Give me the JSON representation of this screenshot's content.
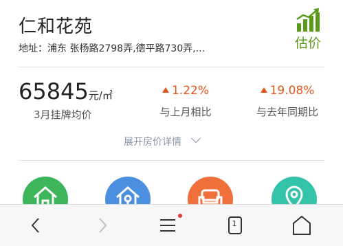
{
  "header": {
    "title": "仁和花苑",
    "address": "地址：浦东 张杨路2798弄,德平路730弄,...",
    "estimate_label": "估价"
  },
  "price": {
    "value": "65845",
    "unit": "元/㎡",
    "label": "3月挂牌均价"
  },
  "stats": [
    {
      "value": "1.22%",
      "label": "与上月相比"
    },
    {
      "value": "19.08%",
      "label": "与去年同期比"
    }
  ],
  "expand_label": "展开房价详情",
  "categories": [
    {
      "icon": "house-icon",
      "color": "#3cb55b"
    },
    {
      "icon": "home-location-icon",
      "color": "#4a8fe0"
    },
    {
      "icon": "sofa-icon",
      "color": "#f0703c"
    },
    {
      "icon": "map-pin-icon",
      "color": "#33c3a8"
    }
  ],
  "nav": {
    "tabs_count": "1"
  },
  "colors": {
    "accent_green": "#5a9a1a",
    "increase_orange": "#e2551c",
    "link_gray": "#8a97a8"
  }
}
